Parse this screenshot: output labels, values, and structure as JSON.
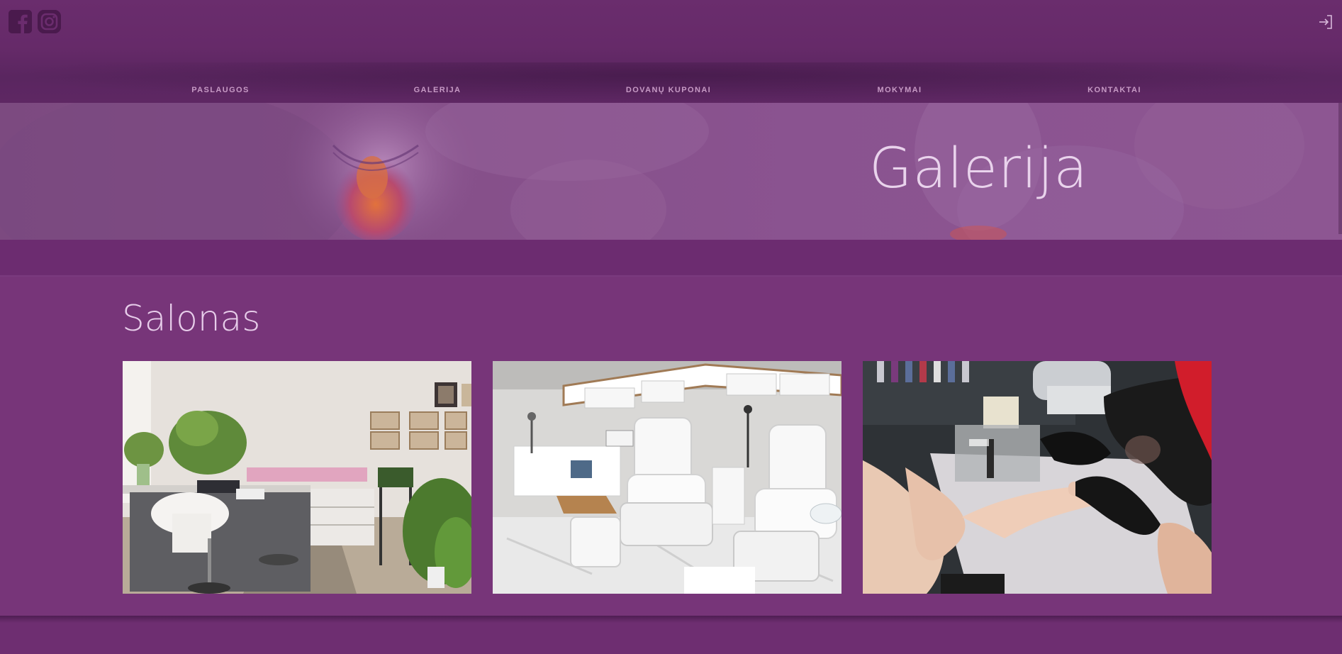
{
  "header": {
    "social": [
      {
        "icon": "facebook-icon"
      },
      {
        "icon": "instagram-icon"
      }
    ],
    "login_icon": "login-icon"
  },
  "nav": {
    "items": [
      {
        "label": "PASLAUGOS"
      },
      {
        "label": "GALERIJA"
      },
      {
        "label": "DOVANŲ KUPONAI"
      },
      {
        "label": "MOKYMAI"
      },
      {
        "label": "KONTAKTAI"
      }
    ]
  },
  "hero": {
    "title": "Galerija"
  },
  "gallery": {
    "section_title": "Salonas",
    "photos": [
      {
        "subject": "salon-desk-photo"
      },
      {
        "subject": "pedicure-chairs-photo"
      },
      {
        "subject": "manicure-procedure-photo"
      }
    ]
  },
  "colors": {
    "background": "#6b2c6e",
    "section": "#773579",
    "hero": "#86508a",
    "nav_text": "#c79ac5",
    "title_text": "#e7cdea"
  }
}
